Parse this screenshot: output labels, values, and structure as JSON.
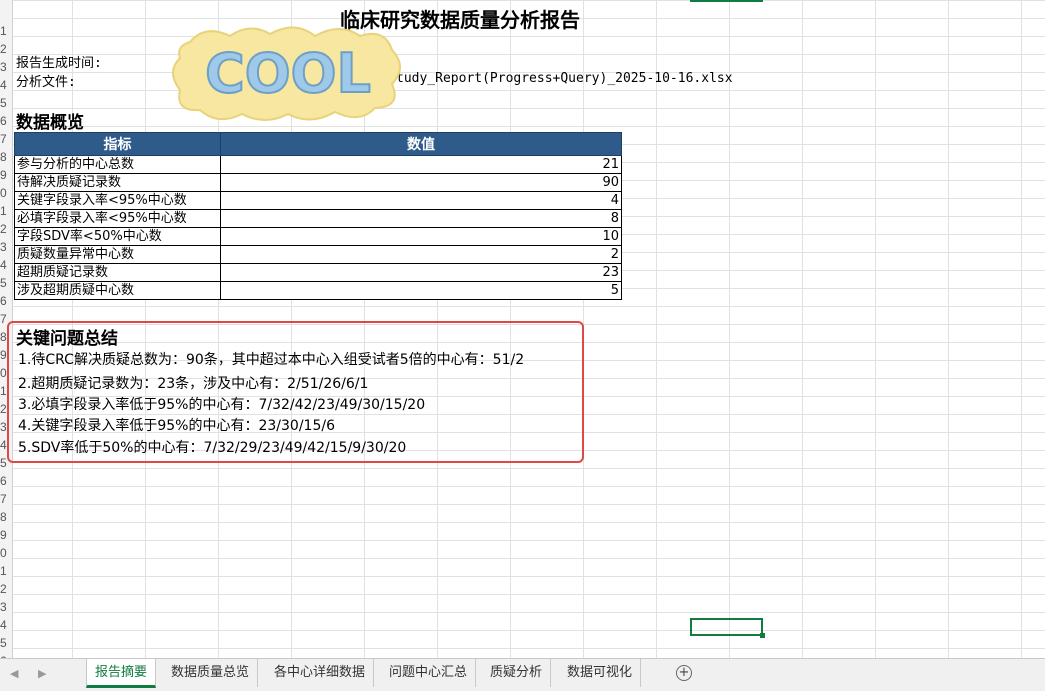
{
  "title": "临床研究数据质量分析报告",
  "meta": {
    "generated_label": "报告生成时间:",
    "file_label": "分析文件:",
    "file_name_visible": "tudy_Report(Progress+Query)_2025-10-16.xlsx"
  },
  "overview": {
    "heading": "数据概览",
    "col_metric": "指标",
    "col_value": "数值",
    "rows": [
      {
        "metric": "参与分析的中心总数",
        "value": "21"
      },
      {
        "metric": "待解决质疑记录数",
        "value": "90"
      },
      {
        "metric": "关键字段录入率<95%中心数",
        "value": "4"
      },
      {
        "metric": "必填字段录入率<95%中心数",
        "value": "8"
      },
      {
        "metric": "字段SDV率<50%中心数",
        "value": "10"
      },
      {
        "metric": "质疑数量异常中心数",
        "value": "2"
      },
      {
        "metric": "超期质疑记录数",
        "value": "23"
      },
      {
        "metric": "涉及超期质疑中心数",
        "value": "5"
      }
    ]
  },
  "issues": {
    "heading": "关键问题总结",
    "items": [
      "1.待CRC解决质疑总数为：90条，其中超过本中心入组受试者5倍的中心有：51/2",
      "2.超期质疑记录数为：23条，涉及中心有：2/51/26/6/1",
      "3.必填字段录入率低于95%的中心有：7/32/42/23/49/30/15/20",
      "4.关键字段录入率低于95%的中心有：23/30/15/6",
      "5.SDV率低于50%的中心有：7/32/29/23/49/42/15/9/30/20"
    ]
  },
  "sticker": {
    "text": "COOL"
  },
  "row_numbers": [
    "1",
    "2",
    "3",
    "4",
    "5",
    "6",
    "7",
    "8",
    "9",
    "0",
    "1",
    "2",
    "3",
    "4",
    "5",
    "6",
    "7",
    "8",
    "9",
    "0",
    "1",
    "2",
    "3",
    "4",
    "5",
    "6",
    "7",
    "8",
    "9",
    "0",
    "1",
    "2",
    "3",
    "4",
    "5",
    "6"
  ],
  "tabs": [
    "报告摘要",
    "数据质量总览",
    "各中心详细数据",
    "问题中心汇总",
    "质疑分析",
    "数据可视化"
  ],
  "colors": {
    "header_blue": "#2f5b8a",
    "accent_green": "#107c41",
    "highlight_red": "#e04848"
  },
  "icons": {
    "nav_prev": "chevron-left-icon",
    "nav_next": "chevron-right-icon",
    "add_sheet": "plus-circle-icon"
  }
}
